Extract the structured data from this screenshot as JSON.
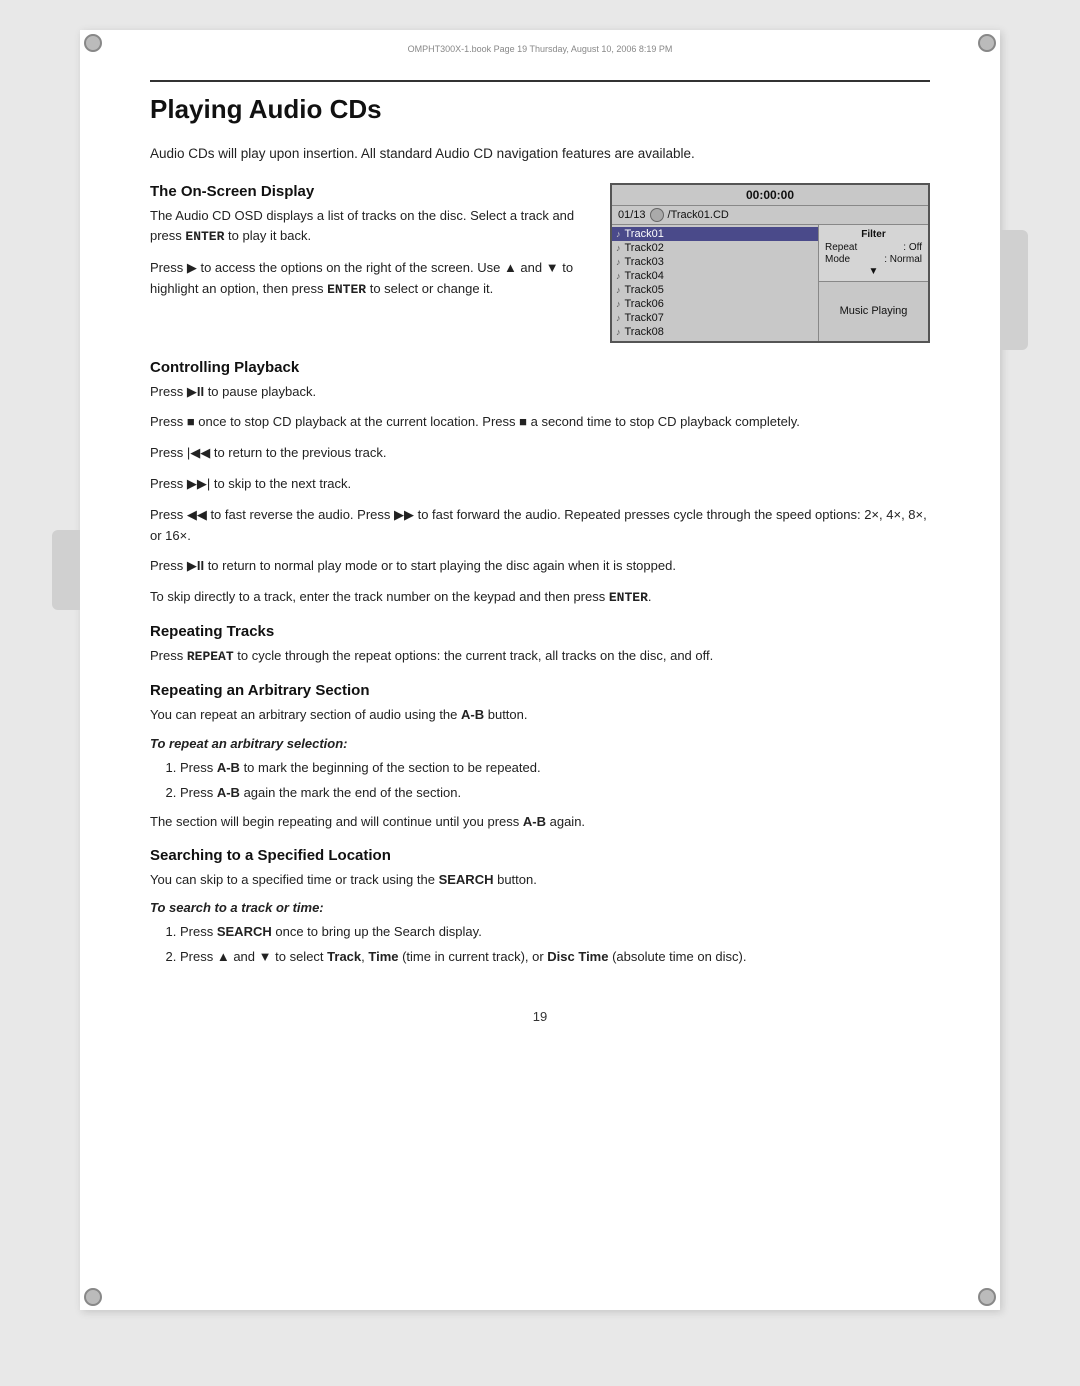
{
  "page": {
    "stamp": "OMPHT300X-1.book  Page 19  Thursday, August 10, 2006  8:19 PM",
    "number": "19"
  },
  "title": "Playing Audio CDs",
  "intro": "Audio CDs will play upon insertion. All standard Audio CD navigation features are available.",
  "osd_section": {
    "heading": "The On-Screen Display",
    "para1": "The Audio CD OSD displays a list of tracks on the disc. Select a track and press ENTER to play it back.",
    "para1_bold": "ENTER",
    "para2": "Press ▶ to access the options on the right of the screen. Use ▲ and ▼ to highlight an option, then press ENTER to select or change it.",
    "para2_bold": "ENTER"
  },
  "osd_display": {
    "time": "00:00:00",
    "track_info": "01/13",
    "disc_label": "/Track01.CD",
    "tracks": [
      {
        "label": "Track01",
        "active": true
      },
      {
        "label": "Track02",
        "active": false
      },
      {
        "label": "Track03",
        "active": false
      },
      {
        "label": "Track04",
        "active": false
      },
      {
        "label": "Track05",
        "active": false
      },
      {
        "label": "Track06",
        "active": false
      },
      {
        "label": "Track07",
        "active": false
      },
      {
        "label": "Track08",
        "active": false
      }
    ],
    "filter": {
      "title": "Filter",
      "repeat_label": "Repeat",
      "repeat_value": ": Off",
      "mode_label": "Mode",
      "mode_value": ": Normal",
      "arrow": "▼"
    },
    "music_playing": "Music Playing"
  },
  "playback_section": {
    "heading": "Controlling Playback",
    "para1": "Press ▶II to pause playback.",
    "para2": "Press ■ once to stop CD playback at the current location. Press ■ a second time to stop CD playback completely.",
    "para3": "Press |◀◀ to return to the previous track.",
    "para4": "Press ▶▶| to skip to the next track.",
    "para5": "Press ◀◀ to fast reverse the audio. Press ▶▶ to fast forward the audio. Repeated presses cycle through the speed options: 2×, 4×, 8×, or 16×.",
    "para6": "Press ▶II to return to normal play mode or to start playing the disc again when it is stopped.",
    "para7_start": "To skip directly to a track, enter the track number on the keypad and then press ",
    "para7_bold": "ENTER",
    "para7_end": "."
  },
  "repeating_section": {
    "heading": "Repeating Tracks",
    "para_start": "Press ",
    "bold": "REPEAT",
    "para_end": " to cycle through the repeat options: the current track, all tracks on the disc, and off."
  },
  "arbitrary_section": {
    "heading": "Repeating an Arbitrary Section",
    "intro": "You can repeat an arbitrary section of audio using the A-B button.",
    "intro_bold": "A-B",
    "subheading": "To repeat an arbitrary selection:",
    "steps": [
      {
        "text": "Press ",
        "bold": "A-B",
        "end": " to mark the beginning of the section to be repeated."
      },
      {
        "text": "Press ",
        "bold": "A-B",
        "end": " again the mark the end of the section."
      }
    ],
    "closing_start": "The section will begin repeating and will continue until you press ",
    "closing_bold": "A-B",
    "closing_end": " again."
  },
  "search_section": {
    "heading": "Searching to a Specified Location",
    "intro_start": "You can skip to a specified time or track using the ",
    "intro_bold": "SEARCH",
    "intro_end": " button.",
    "subheading": "To search to a track or time:",
    "steps": [
      {
        "text": "Press ",
        "bold": "SEARCH",
        "end": " once to bring up the Search display."
      },
      {
        "text_start": "Press ",
        "bold1": "▲",
        "mid1": " and ",
        "bold2": "▼",
        "mid2": " to select ",
        "bold3": "Track",
        "sep1": ", ",
        "bold4": "Time",
        "note": " (time in current track), or ",
        "bold5": "Disc Time",
        "end": " (absolute time on disc)."
      }
    ]
  }
}
